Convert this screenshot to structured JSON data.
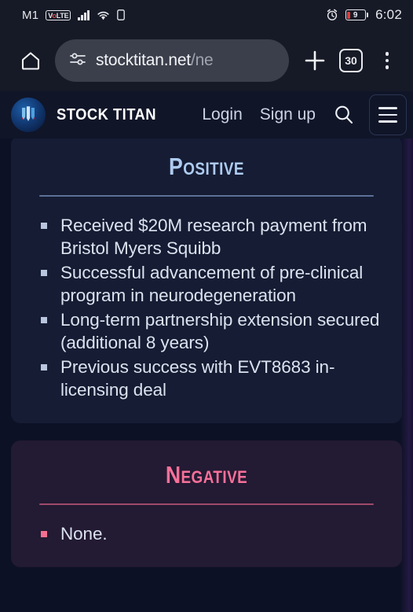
{
  "status_bar": {
    "carrier": "M1",
    "network_badge": "VoLTE",
    "icons": [
      "signal-bars-icon",
      "wifi-icon",
      "sim-card-icon",
      "alarm-icon"
    ],
    "battery_percent": "9",
    "time": "6:02"
  },
  "browser": {
    "home_label": "home-button",
    "url_primary": "stocktitan.net",
    "url_dim": "/ne",
    "new_tab_label": "+",
    "tab_count": "30",
    "menu_label": "more-options"
  },
  "site_header": {
    "brand": "STOCK TITAN",
    "login_label": "Login",
    "signup_label": "Sign up",
    "search_label": "search",
    "menu_label": "menu"
  },
  "cards": [
    {
      "title": "Positive",
      "accent": "#aecbf0",
      "rule_color": "#5d7099",
      "bullets": [
        "Received $20M research payment from Bristol Myers Squibb",
        "Successful advancement of pre-clinical program in neurodegeneration",
        "Long-term partnership extension secured (additional 8 years)",
        "Previous success with EVT8683 in-licensing deal"
      ]
    },
    {
      "title": "Negative",
      "accent": "#f87099",
      "rule_color": "#a04a6a",
      "bullets": [
        "None."
      ]
    }
  ]
}
